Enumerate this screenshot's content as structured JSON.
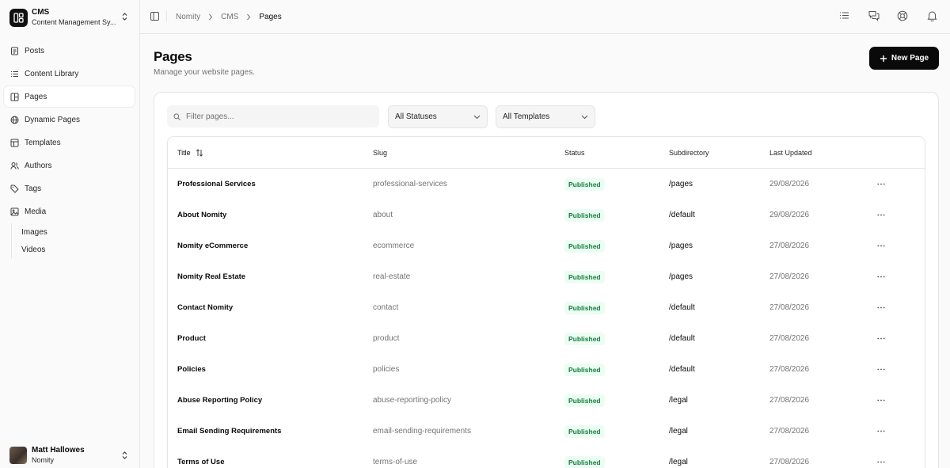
{
  "sidebar": {
    "brand_title": "CMS",
    "brand_subtitle": "Content Management Sy...",
    "items": [
      {
        "label": "Posts",
        "icon": "file-text-icon"
      },
      {
        "label": "Content Library",
        "icon": "list-icon"
      },
      {
        "label": "Pages",
        "icon": "layout-icon",
        "active": true
      },
      {
        "label": "Dynamic Pages",
        "icon": "globe-icon"
      },
      {
        "label": "Templates",
        "icon": "template-icon"
      },
      {
        "label": "Authors",
        "icon": "users-icon"
      },
      {
        "label": "Tags",
        "icon": "tag-icon"
      },
      {
        "label": "Media",
        "icon": "image-icon"
      }
    ],
    "media_sub": [
      "Images",
      "Videos"
    ],
    "user": {
      "name": "Matt Hallowes",
      "org": "Nomity"
    }
  },
  "topbar": {
    "breadcrumb": [
      "Nomity",
      "CMS",
      "Pages"
    ],
    "icons": [
      "list-icon",
      "messages-icon",
      "help-icon",
      "bell-icon"
    ]
  },
  "header": {
    "title": "Pages",
    "subtitle": "Manage your website pages.",
    "new_button": "New Page"
  },
  "filters": {
    "search_placeholder": "Filter pages...",
    "status": "All Statuses",
    "template": "All Templates"
  },
  "table": {
    "columns": [
      "Title",
      "Slug",
      "Status",
      "Subdirectory",
      "Last Updated"
    ],
    "rows": [
      {
        "title": "Professional Services",
        "slug": "professional-services",
        "status": "Published",
        "subdirectory": "/pages",
        "updated": "29/08/2026"
      },
      {
        "title": "About Nomity",
        "slug": "about",
        "status": "Published",
        "subdirectory": "/default",
        "updated": "29/08/2026"
      },
      {
        "title": "Nomity eCommerce",
        "slug": "ecommerce",
        "status": "Published",
        "subdirectory": "/pages",
        "updated": "27/08/2026"
      },
      {
        "title": "Nomity Real Estate",
        "slug": "real-estate",
        "status": "Published",
        "subdirectory": "/pages",
        "updated": "27/08/2026"
      },
      {
        "title": "Contact Nomity",
        "slug": "contact",
        "status": "Published",
        "subdirectory": "/default",
        "updated": "27/08/2026"
      },
      {
        "title": "Product",
        "slug": "product",
        "status": "Published",
        "subdirectory": "/default",
        "updated": "27/08/2026"
      },
      {
        "title": "Policies",
        "slug": "policies",
        "status": "Published",
        "subdirectory": "/default",
        "updated": "27/08/2026"
      },
      {
        "title": "Abuse Reporting Policy",
        "slug": "abuse-reporting-policy",
        "status": "Published",
        "subdirectory": "/legal",
        "updated": "27/08/2026"
      },
      {
        "title": "Email Sending Requirements",
        "slug": "email-sending-requirements",
        "status": "Published",
        "subdirectory": "/legal",
        "updated": "27/08/2026"
      },
      {
        "title": "Terms of Use",
        "slug": "terms-of-use",
        "status": "Published",
        "subdirectory": "/legal",
        "updated": "27/08/2026"
      }
    ]
  }
}
